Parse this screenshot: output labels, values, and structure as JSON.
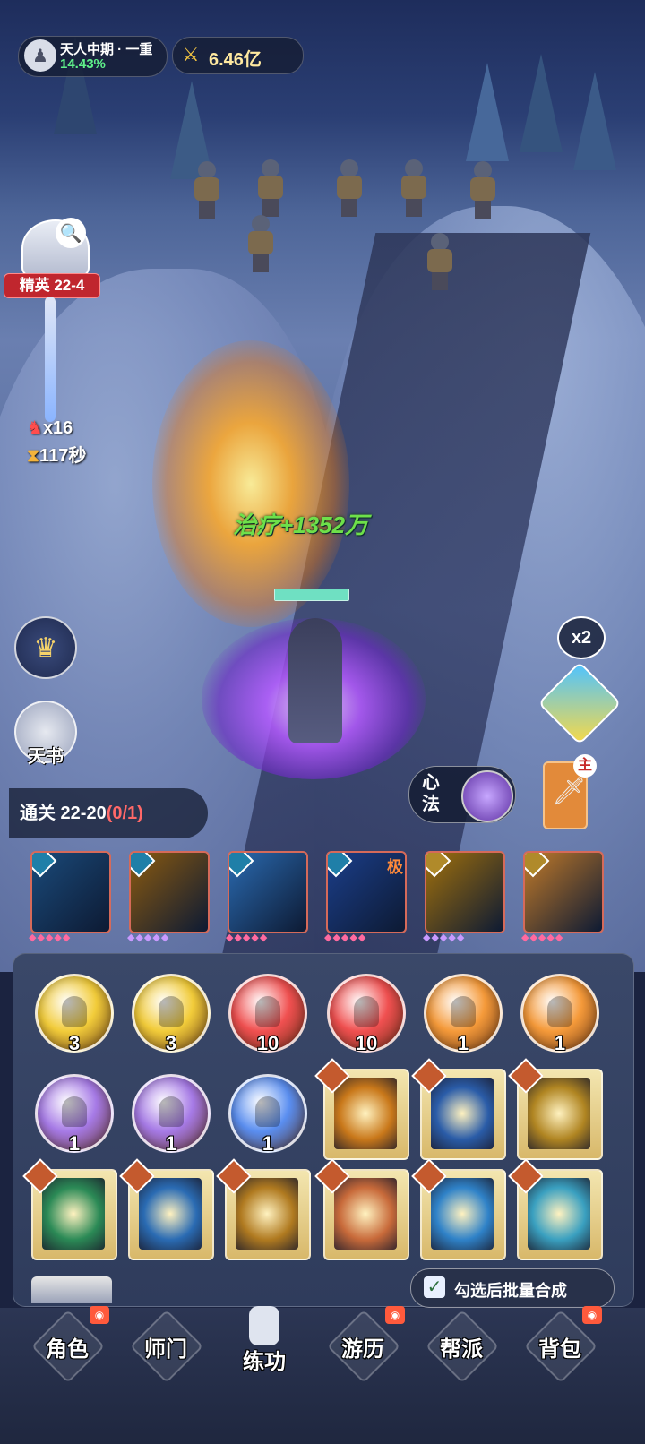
{
  "status": {
    "realm": "天人中期 · 一重",
    "progress": "14.43%",
    "power": "6.46亿"
  },
  "stage": {
    "tag": "精英 22-4",
    "kills": "x16",
    "time": "117秒"
  },
  "battle": {
    "heal_text": "治疗+1352万"
  },
  "side": {
    "tianshu_label": "天书",
    "speed_label": "x2"
  },
  "quest": {
    "label": "通关 22-20",
    "progress": "(0/1)"
  },
  "xinfa": {
    "label": "心法"
  },
  "weapon": {
    "badge": "主"
  },
  "skill_cards": [
    {
      "icon": "ice",
      "color": "#1a4a7a",
      "dots_color": "#ff6aa0"
    },
    {
      "icon": "lightning",
      "color": "#8a5a10",
      "dots_color": "#c99aff"
    },
    {
      "icon": "cubes",
      "color": "#2a6ab0",
      "dots_color": "#ff6aa0"
    },
    {
      "icon": "orb",
      "color": "#1b3e8a",
      "dots_color": "#ff6aa0",
      "tag": "极"
    },
    {
      "icon": "sword-rain",
      "color": "#a0700c",
      "dots_color": "#c99aff"
    },
    {
      "icon": "comets",
      "color": "#c07a2a",
      "dots_color": "#ff6aa0"
    }
  ],
  "beads": [
    {
      "count": "3",
      "color": "#f2cc3a"
    },
    {
      "count": "3",
      "color": "#f2cc3a"
    },
    {
      "count": "10",
      "color": "#f05050"
    },
    {
      "count": "10",
      "color": "#f05050"
    },
    {
      "count": "1",
      "color": "#f59a3a"
    },
    {
      "count": "1",
      "color": "#f59a3a"
    },
    {
      "count": "1",
      "color": "#a67ae6"
    },
    {
      "count": "1",
      "color": "#a67ae6"
    },
    {
      "count": "1",
      "color": "#5a8ef0"
    }
  ],
  "books": [
    {
      "icon": "monk",
      "color": "#c9781a"
    },
    {
      "icon": "taiji",
      "color": "#2a5ca8"
    },
    {
      "icon": "sword",
      "color": "#b08522"
    },
    {
      "icon": "leaf",
      "color": "#2b8a56"
    },
    {
      "icon": "storm",
      "color": "#2a6bb3"
    },
    {
      "icon": "sword",
      "color": "#b07a20"
    },
    {
      "icon": "sword",
      "color": "#c86a3a"
    },
    {
      "icon": "wave",
      "color": "#2f82c8"
    },
    {
      "icon": "wave",
      "color": "#3aa0c0"
    }
  ],
  "batch": {
    "label": "勾选后批量合成",
    "checked": true
  },
  "nav": [
    {
      "label": "角色",
      "badge": true
    },
    {
      "label": "师门",
      "badge": false
    },
    {
      "label": "练功",
      "badge": false,
      "active": true
    },
    {
      "label": "游历",
      "badge": true
    },
    {
      "label": "帮派",
      "badge": false
    },
    {
      "label": "背包",
      "badge": true
    }
  ]
}
